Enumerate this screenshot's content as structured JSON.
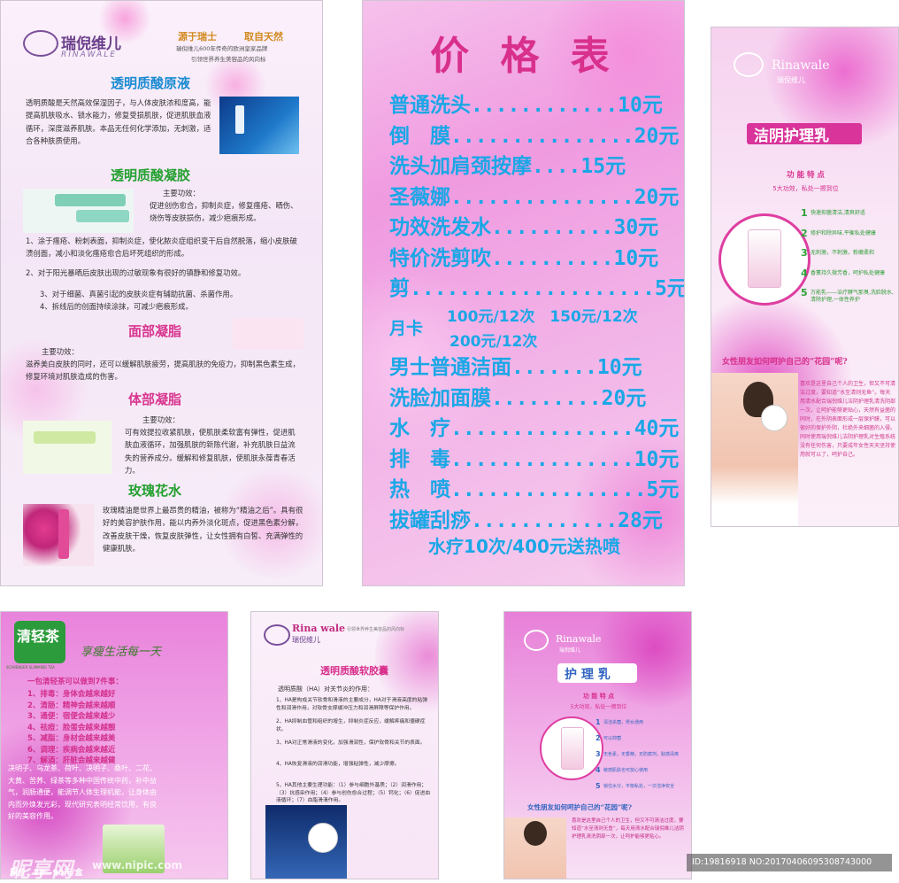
{
  "panel1": {
    "brand_cn": "瑞倪维儿",
    "brand_en": "RINAWALE",
    "slogan_left": "源于瑞士",
    "slogan_right": "取自天然",
    "tagline1": "瑞倪维儿600年传奇的欧洲皇家品牌",
    "tagline2": "引领世界养生美容品的风向标",
    "sec1_title": "透明质酸原液",
    "sec1_body": "透明质酸是天然高效保湿因子，与人体皮肤浓和度高，能提高肌肤吸水、锁水能力，修复受损肌肤，促进肌肤血液循环，深度滋养肌肤。本品无任何化学添加，无刺激，适合各种肤质使用。",
    "sec2_title": "透明质酸凝胶",
    "sec2_intro": "主要功效：",
    "sec2_body1": "促进创伤愈合，抑制炎症，修复瘙疮、晒伤、烧伤等皮肤损伤，减少疤痕形成。",
    "sec2_body2": "1、涂于瘙疮、粉刺表面，抑制炎症，使化脓炎症组织变干后自然脱落，缩小皮肤破溃创面，减小和淡化瘙疮愈合后坏死组织的形成。",
    "sec2_body3": "2、对于阳光暴晒后皮肤出现的过敏现象有很好的镇静和修复功效。",
    "sec2_body4": "3、对于细菌、真菌引起的皮肤炎症有辅助抗菌、杀菌作用。",
    "sec2_body5": "4、拆线后的创面持续涂抹，可减少疤痕形成。",
    "sec3_title": "面部凝脂",
    "sec3_intro": "主要功效：",
    "sec3_body": "滋养美白皮肤的同时，还可以缓解肌肤疲劳，提高肌肤的免疫力，抑制黑色素生成，修复环境对肌肤造成的伤害。",
    "sec4_title": "体部凝脂",
    "sec4_intro": "主要功效：",
    "sec4_body": "可有效提拉收紧肌肤，使肌肤柔软富有弹性，促进肌肤血液循环，加强肌肤的新陈代谢，补充肌肤日益流失的营养成分。缓解和修复肌肤，使肌肤永葆青春活力。",
    "sec5_title": "玫瑰花水",
    "sec5_body": "玫瑰精油是世界上最昂贵的精油，被称为“精油之后”。具有很好的美容护肤作用，能以内养外淡化斑点，促进黑色素分解，改善皮肤干燥，恢复皮肤弹性，让女性拥有白皙、充满弹性的健康肌肤。"
  },
  "panel2": {
    "title": "价 格 表",
    "rows": [
      "普通洗头............10元",
      "倒　膜...............20元",
      "洗头加肩颈按摩....15元",
      "圣薇娜...............20元",
      "功效洗发水..........30元",
      "特价洗剪吹..........10元",
      "剪....................5元"
    ],
    "monthly_label": "月卡",
    "monthly_line1": "100元/12次　150元/12次",
    "monthly_line2": "200元/12次",
    "rows2": [
      "男士普通洁面.......10元",
      "洗脸加面膜.........20元",
      "水　疗...............40元",
      "排　毒...............10元",
      "热　喷................5元",
      "拔罐刮痧............28元"
    ],
    "footer": "水疗10次/400元送热喷"
  },
  "panel3": {
    "brand_en": "Rinawale",
    "brand_cn": "瑞倪维儿",
    "title": "洁阴护理乳",
    "feature_title": "功 能 特 点",
    "feature_sub": "5大功效，私处一擦到位",
    "features": [
      "快速抑菌清洁,清爽舒适",
      "修护和除异味,平衡私处健康",
      "无刺激，不刺激，粉嫩柔和",
      "香薰持久微芳香，呵护私处健康",
      "万能乳——治疗酵气那臭,洗脸脱水,清除护理,一体性养护"
    ],
    "question": "女性朋友如何呵护自己的“花园”呢?",
    "body": "喜欢是这里自己个人的卫生，但又不可清洁过度，要知道“水至清则无鱼”。每天用清水配合瑞倪维儿洁阴护理乳清洗阴部一次，让呵护能够更贴心，天然有益菌的同时，在外阴表面形成一层保护膜，可以很好的保护外阴，杜绝外来细菌的入侵。同时使用瑞倪维儿洁阴护理乳对生殖系统没有任何伤害，只要成年女性天天坚持使用就可以了，呵护自己。"
  },
  "panel4": {
    "brand": "清轻茶",
    "brand_en": "SCAVENGER SLIMMING TEA",
    "slogan": "享瘦生活每一天",
    "intro": "一包清轻茶可以做到7件事：",
    "items": [
      "1、排毒：身体会越来越好",
      "2、清肠：精神会越来越顺",
      "3、通便：宿便会越来越少",
      "4、祛痘：脸蛋会越来越靓",
      "5、减脂：身材会越来越美",
      "6、调理：疾病会越来越近",
      "7、解酒：肝脏会越来越健"
    ],
    "body": "决明子、乌龙茶、荷叶、决明子、桑叶、二花、大黄、苦荞、绿茶等多种中国传统中药，补中益气，润肠通便，能调节人体生理机能，让身体由内而外焕发光彩，现代研究表明经常饮用，有良好的美容作用。",
    "footer": "原价：80—90元/盒"
  },
  "panel5": {
    "brand_en": "Rina wale",
    "brand_cn": "瑞倪维儿",
    "tagline": "引领世界养生美容品的风向标",
    "title": "透明质酸软胶囊",
    "intro": "透明质酸（HA）对关节炎的作用：",
    "lines": [
      "1、HA是构成关节软骨和滑液的主要成分，HA对于滑液高度的粘弹性和润滑作用，对软骨支撑缓冲压力和润滑屏障等保护作用。",
      "2、HA抑制血管和组织的增生，抑制炎症反应，缓解疼痛和僵硬症状。",
      "3、HA对正常滑液的变化，加强滑润性，保护软骨和关节的表面。",
      "4、HA恢复滑液的润滑功能，增强粘弹性，减少摩擦。",
      "5、HA其他主要生理功能：（1）参与细胞外基质；（2）润滑作用；（3）抗感染作用；（4）参与创伤愈合过程；（5）钙化；（6）促进血液循环；（7）血脂滑清作用。"
    ]
  },
  "panel6": {
    "brand_en": "Rinawale",
    "brand_cn": "瑞倪维儿",
    "title": "护 理 乳",
    "feature_title": "功 能 特 点",
    "feature_sub": "5大功效，私处一擦到位",
    "features": [
      "清洁杀菌，男女通用",
      "可以抑菌",
      "无色素，无香精，无防腐剂，肤感清爽",
      "敏感肌肤也可放心使用",
      "锁住水分，平衡私处，一次洁净安全"
    ],
    "question": "女性朋友如何呵护自己的“花园”呢?",
    "body": "喜欢是这里自己个人的卫生，但又不可清洁过度，要知道“水至清则无鱼”，每天用清水配合瑞倪维儿洁阴护理乳清洗阴部一次，让呵护能够更贴心。"
  },
  "watermark": {
    "site": "昵享网",
    "site_en": "www.nipic.com",
    "id": "ID:19816918 NO:20170406095308743000"
  },
  "colors": {
    "price_text": "#1aa7e6",
    "pink_title": "#d8368f",
    "green_title": "#23a02f",
    "blue_title": "#1b8bd1"
  }
}
